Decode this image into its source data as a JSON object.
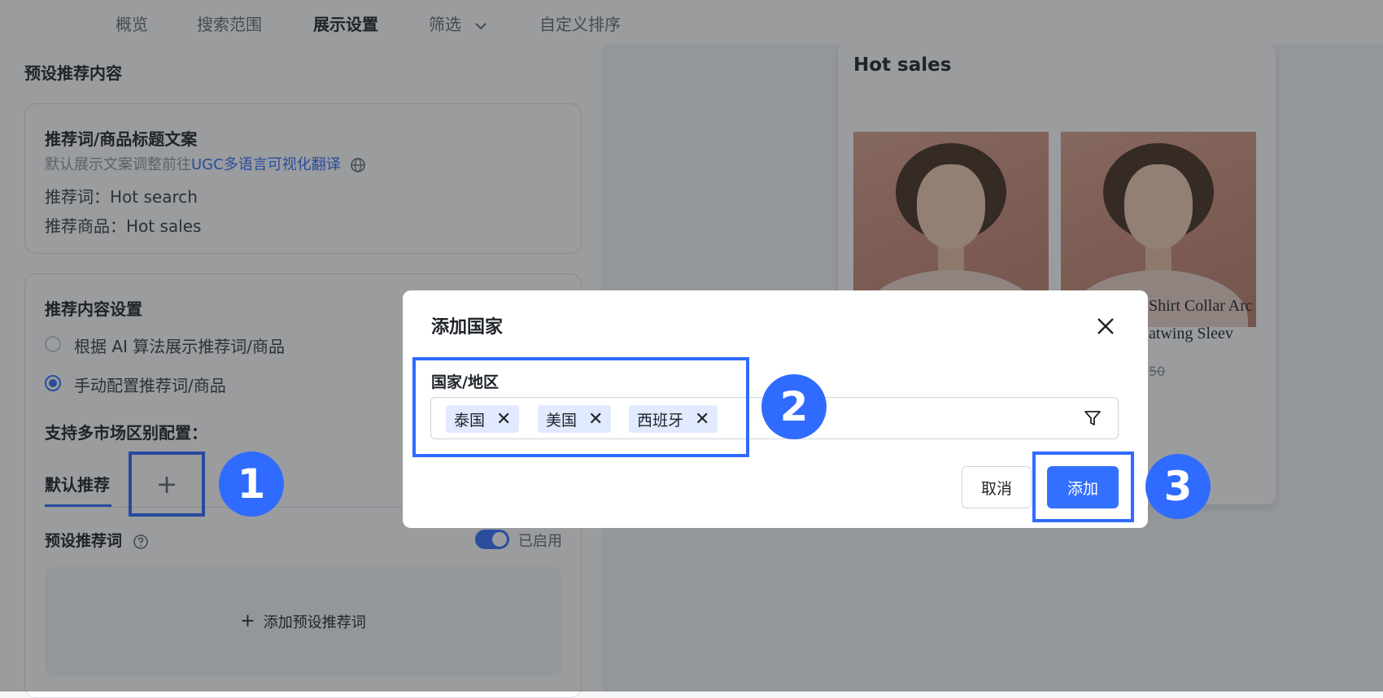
{
  "tabs": [
    {
      "label": "概览"
    },
    {
      "label": "搜索范围"
    },
    {
      "label": "展示设置"
    },
    {
      "label": "筛选"
    },
    {
      "label": "自定义排序"
    }
  ],
  "left": {
    "preset_title": "预设推荐内容",
    "copy_card": {
      "title": "推荐词/商品标题文案",
      "desc_prefix": "默认展示文案调整前往",
      "desc_link": "UGC多语言可视化翻译",
      "word": "推荐词：Hot search",
      "product": "推荐商品：Hot sales"
    },
    "settings_card": {
      "title": "推荐内容设置",
      "option_ai": "根据 AI 算法展示推荐词/商品",
      "option_manual": "手动配置推荐词/商品",
      "multi_market": "支持多市场区别配置：",
      "default_tab": "默认推荐",
      "add_tab_symbol": "+",
      "preset_words": "预设推荐词",
      "enabled": "已启用",
      "add_preset": "添加预设推荐词"
    }
  },
  "preview": {
    "title": "Hot sales",
    "product_line1": "Shirt Collar Arc",
    "product_line2": "atwing Sleev",
    "price_fragment": "50"
  },
  "modal": {
    "title": "添加国家",
    "field_label": "国家/地区",
    "tags": [
      "泰国",
      "美国",
      "西班牙"
    ],
    "cancel": "取消",
    "confirm": "添加"
  },
  "steps": [
    "1",
    "2",
    "3"
  ],
  "colors": {
    "accent": "#3370ff",
    "highlight": "#2f6bff",
    "tag_bg": "#e1eaff"
  }
}
